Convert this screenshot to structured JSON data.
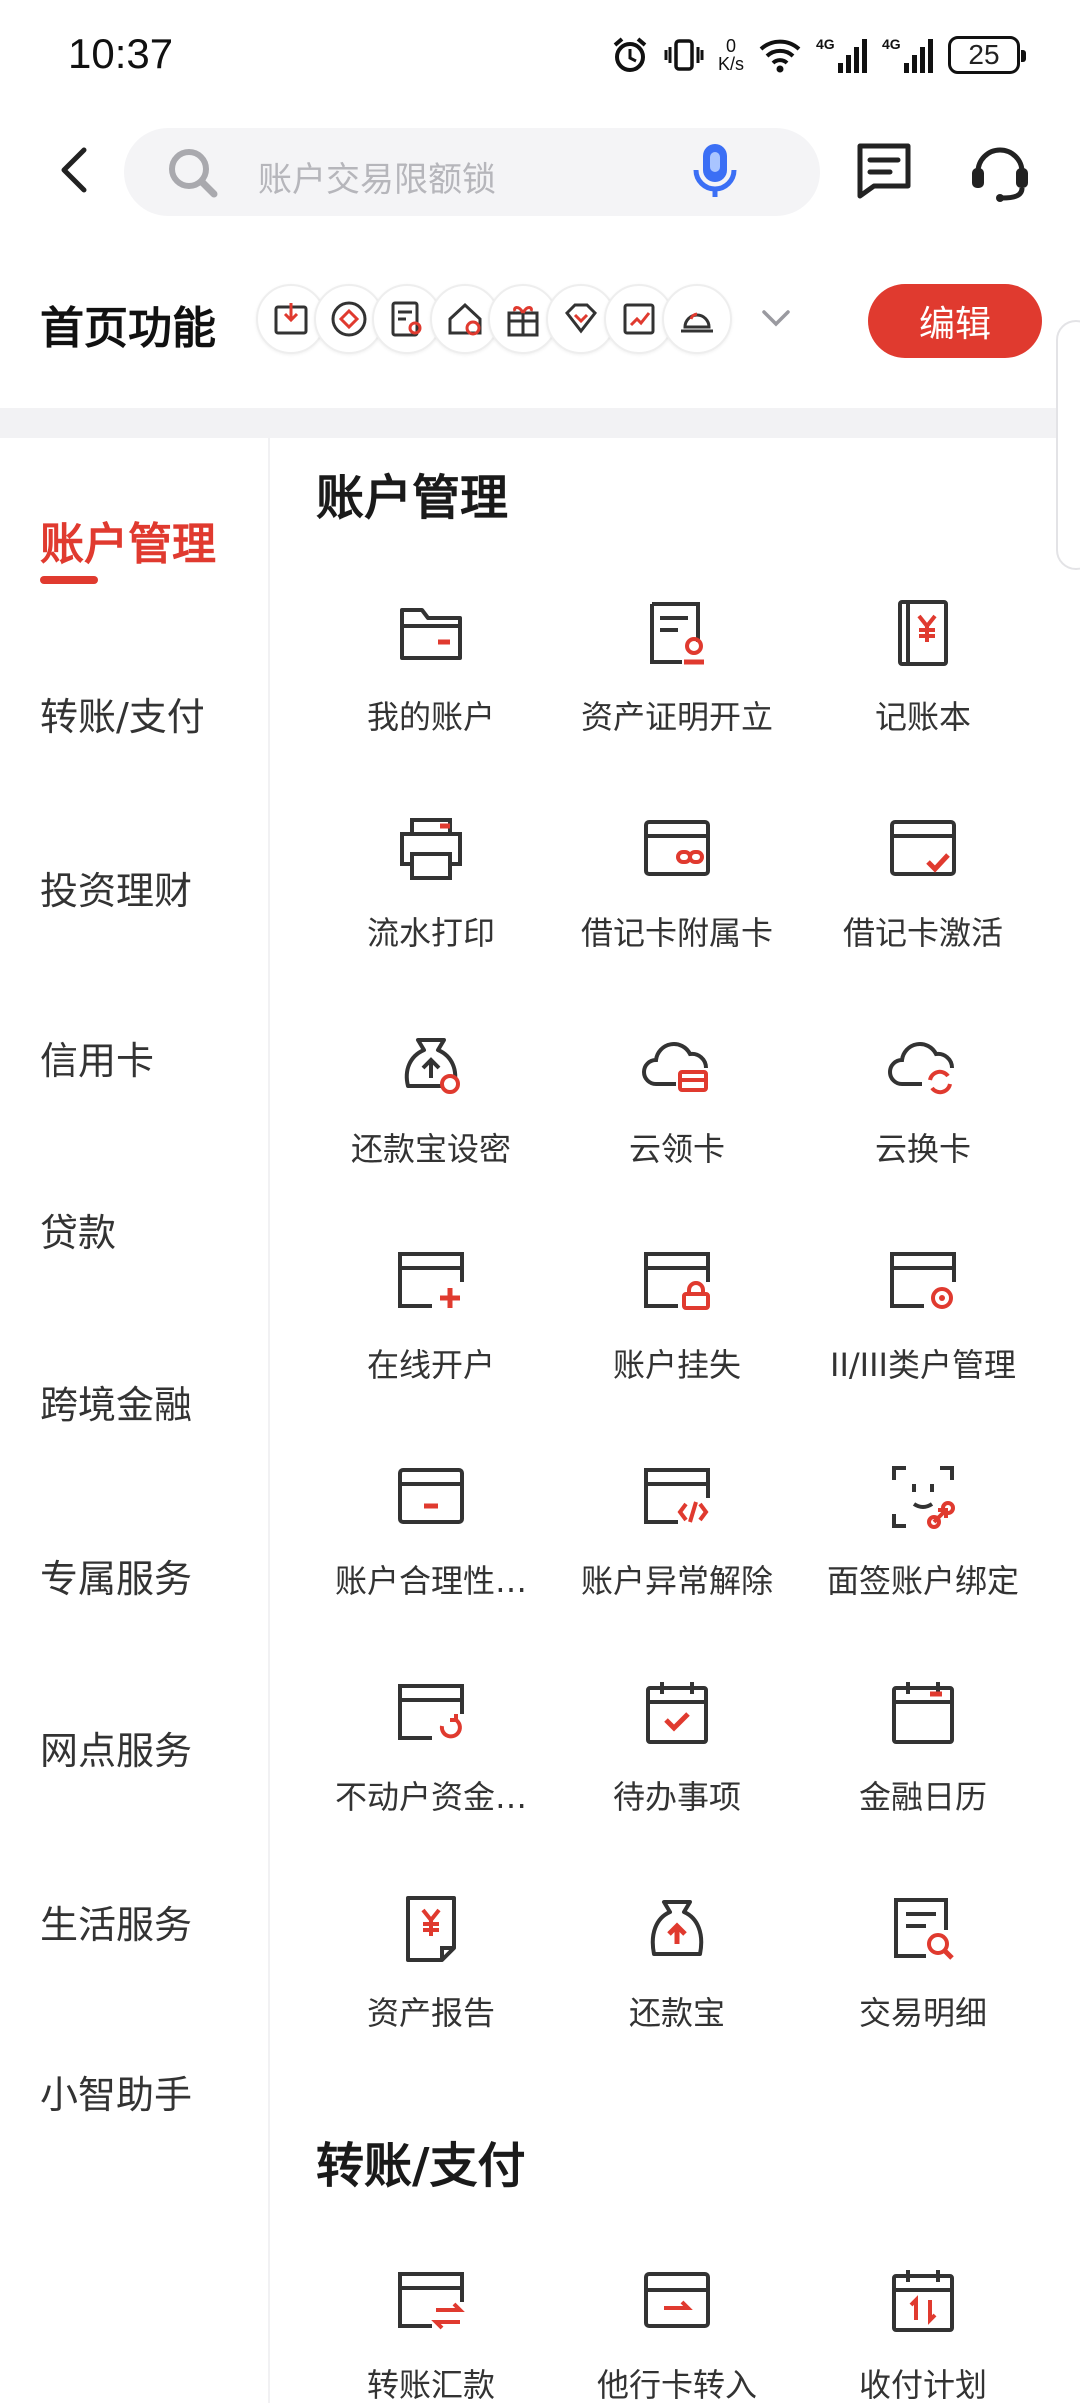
{
  "status_bar": {
    "time": "10:37",
    "net_speed_value": "0",
    "net_speed_unit": "K/s",
    "battery": "25",
    "icons": [
      "alarm-icon",
      "vibrate-icon",
      "wifi-icon",
      "signal-4g-icon",
      "signal-4g-icon",
      "battery-icon"
    ]
  },
  "header": {
    "search_placeholder": "账户交易限额锁",
    "icons": [
      "back-icon",
      "search-icon",
      "microphone-icon",
      "message-icon",
      "customer-service-icon"
    ]
  },
  "home_functions": {
    "title": "首页功能",
    "edit_label": "编辑",
    "quick_icons": [
      "download-icon",
      "diamond-circle-icon",
      "document-search-icon",
      "house-icon",
      "gift-icon",
      "diamond-icon",
      "trend-icon",
      "bell-icon"
    ]
  },
  "categories": [
    {
      "label": "账户管理",
      "active": true
    },
    {
      "label": "转账/支付",
      "active": false
    },
    {
      "label": "投资理财",
      "active": false
    },
    {
      "label": "信用卡",
      "active": false
    },
    {
      "label": "贷款",
      "active": false
    },
    {
      "label": "跨境金融",
      "active": false
    },
    {
      "label": "专属服务",
      "active": false
    },
    {
      "label": "网点服务",
      "active": false
    },
    {
      "label": "生活服务",
      "active": false
    },
    {
      "label": "小智助手",
      "active": false
    }
  ],
  "sections": [
    {
      "title": "账户管理",
      "items": [
        {
          "label": "我的账户",
          "icon": "folder-icon"
        },
        {
          "label": "资产证明开立",
          "icon": "certificate-icon"
        },
        {
          "label": "记账本",
          "icon": "ledger-icon"
        },
        {
          "label": "流水打印",
          "icon": "printer-icon"
        },
        {
          "label": "借记卡附属卡",
          "icon": "card-link-icon"
        },
        {
          "label": "借记卡激活",
          "icon": "card-check-icon"
        },
        {
          "label": "还款宝设密",
          "icon": "moneybag-gear-icon"
        },
        {
          "label": "云领卡",
          "icon": "cloud-card-icon"
        },
        {
          "label": "云换卡",
          "icon": "cloud-refresh-icon"
        },
        {
          "label": "在线开户",
          "icon": "card-plus-icon"
        },
        {
          "label": "账户挂失",
          "icon": "card-lock-icon"
        },
        {
          "label": "II/III类户管理",
          "icon": "card-gear-icon"
        },
        {
          "label": "账户合理性…",
          "icon": "card-minus-icon"
        },
        {
          "label": "账户异常解除",
          "icon": "card-code-icon"
        },
        {
          "label": "面签账户绑定",
          "icon": "face-link-icon"
        },
        {
          "label": "不动户资金…",
          "icon": "card-refresh-icon"
        },
        {
          "label": "待办事项",
          "icon": "calendar-check-icon"
        },
        {
          "label": "金融日历",
          "icon": "calendar-icon"
        },
        {
          "label": "资产报告",
          "icon": "report-yen-icon"
        },
        {
          "label": "还款宝",
          "icon": "moneybag-up-icon"
        },
        {
          "label": "交易明细",
          "icon": "document-search-icon"
        }
      ]
    },
    {
      "title": "转账/支付",
      "items": [
        {
          "label": "转账汇款",
          "icon": "transfer-icon"
        },
        {
          "label": "他行卡转入",
          "icon": "card-in-icon"
        },
        {
          "label": "收付计划",
          "icon": "calendar-sort-icon"
        }
      ]
    }
  ],
  "colors": {
    "accent": "#e03a2f",
    "icon_stroke": "#333333",
    "background": "#ffffff"
  }
}
